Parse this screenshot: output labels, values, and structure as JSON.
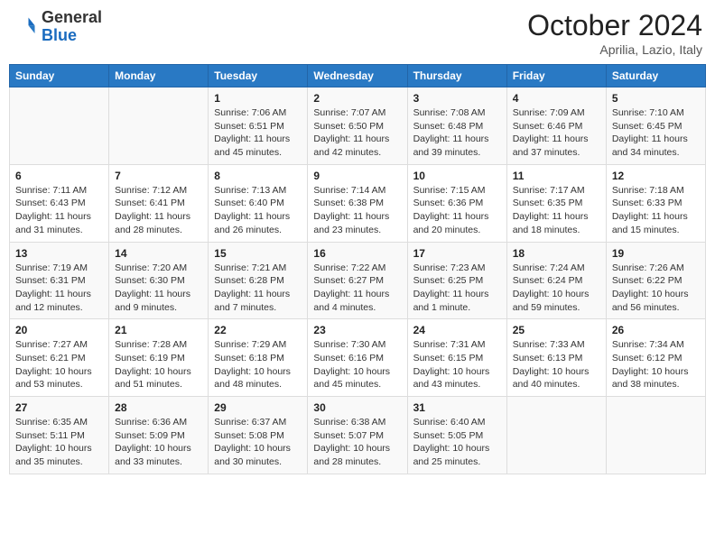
{
  "header": {
    "logo_general": "General",
    "logo_blue": "Blue",
    "month_title": "October 2024",
    "location": "Aprilia, Lazio, Italy"
  },
  "days_of_week": [
    "Sunday",
    "Monday",
    "Tuesday",
    "Wednesday",
    "Thursday",
    "Friday",
    "Saturday"
  ],
  "weeks": [
    [
      {
        "day": "",
        "info": ""
      },
      {
        "day": "",
        "info": ""
      },
      {
        "day": "1",
        "info": "Sunrise: 7:06 AM\nSunset: 6:51 PM\nDaylight: 11 hours and 45 minutes."
      },
      {
        "day": "2",
        "info": "Sunrise: 7:07 AM\nSunset: 6:50 PM\nDaylight: 11 hours and 42 minutes."
      },
      {
        "day": "3",
        "info": "Sunrise: 7:08 AM\nSunset: 6:48 PM\nDaylight: 11 hours and 39 minutes."
      },
      {
        "day": "4",
        "info": "Sunrise: 7:09 AM\nSunset: 6:46 PM\nDaylight: 11 hours and 37 minutes."
      },
      {
        "day": "5",
        "info": "Sunrise: 7:10 AM\nSunset: 6:45 PM\nDaylight: 11 hours and 34 minutes."
      }
    ],
    [
      {
        "day": "6",
        "info": "Sunrise: 7:11 AM\nSunset: 6:43 PM\nDaylight: 11 hours and 31 minutes."
      },
      {
        "day": "7",
        "info": "Sunrise: 7:12 AM\nSunset: 6:41 PM\nDaylight: 11 hours and 28 minutes."
      },
      {
        "day": "8",
        "info": "Sunrise: 7:13 AM\nSunset: 6:40 PM\nDaylight: 11 hours and 26 minutes."
      },
      {
        "day": "9",
        "info": "Sunrise: 7:14 AM\nSunset: 6:38 PM\nDaylight: 11 hours and 23 minutes."
      },
      {
        "day": "10",
        "info": "Sunrise: 7:15 AM\nSunset: 6:36 PM\nDaylight: 11 hours and 20 minutes."
      },
      {
        "day": "11",
        "info": "Sunrise: 7:17 AM\nSunset: 6:35 PM\nDaylight: 11 hours and 18 minutes."
      },
      {
        "day": "12",
        "info": "Sunrise: 7:18 AM\nSunset: 6:33 PM\nDaylight: 11 hours and 15 minutes."
      }
    ],
    [
      {
        "day": "13",
        "info": "Sunrise: 7:19 AM\nSunset: 6:31 PM\nDaylight: 11 hours and 12 minutes."
      },
      {
        "day": "14",
        "info": "Sunrise: 7:20 AM\nSunset: 6:30 PM\nDaylight: 11 hours and 9 minutes."
      },
      {
        "day": "15",
        "info": "Sunrise: 7:21 AM\nSunset: 6:28 PM\nDaylight: 11 hours and 7 minutes."
      },
      {
        "day": "16",
        "info": "Sunrise: 7:22 AM\nSunset: 6:27 PM\nDaylight: 11 hours and 4 minutes."
      },
      {
        "day": "17",
        "info": "Sunrise: 7:23 AM\nSunset: 6:25 PM\nDaylight: 11 hours and 1 minute."
      },
      {
        "day": "18",
        "info": "Sunrise: 7:24 AM\nSunset: 6:24 PM\nDaylight: 10 hours and 59 minutes."
      },
      {
        "day": "19",
        "info": "Sunrise: 7:26 AM\nSunset: 6:22 PM\nDaylight: 10 hours and 56 minutes."
      }
    ],
    [
      {
        "day": "20",
        "info": "Sunrise: 7:27 AM\nSunset: 6:21 PM\nDaylight: 10 hours and 53 minutes."
      },
      {
        "day": "21",
        "info": "Sunrise: 7:28 AM\nSunset: 6:19 PM\nDaylight: 10 hours and 51 minutes."
      },
      {
        "day": "22",
        "info": "Sunrise: 7:29 AM\nSunset: 6:18 PM\nDaylight: 10 hours and 48 minutes."
      },
      {
        "day": "23",
        "info": "Sunrise: 7:30 AM\nSunset: 6:16 PM\nDaylight: 10 hours and 45 minutes."
      },
      {
        "day": "24",
        "info": "Sunrise: 7:31 AM\nSunset: 6:15 PM\nDaylight: 10 hours and 43 minutes."
      },
      {
        "day": "25",
        "info": "Sunrise: 7:33 AM\nSunset: 6:13 PM\nDaylight: 10 hours and 40 minutes."
      },
      {
        "day": "26",
        "info": "Sunrise: 7:34 AM\nSunset: 6:12 PM\nDaylight: 10 hours and 38 minutes."
      }
    ],
    [
      {
        "day": "27",
        "info": "Sunrise: 6:35 AM\nSunset: 5:11 PM\nDaylight: 10 hours and 35 minutes."
      },
      {
        "day": "28",
        "info": "Sunrise: 6:36 AM\nSunset: 5:09 PM\nDaylight: 10 hours and 33 minutes."
      },
      {
        "day": "29",
        "info": "Sunrise: 6:37 AM\nSunset: 5:08 PM\nDaylight: 10 hours and 30 minutes."
      },
      {
        "day": "30",
        "info": "Sunrise: 6:38 AM\nSunset: 5:07 PM\nDaylight: 10 hours and 28 minutes."
      },
      {
        "day": "31",
        "info": "Sunrise: 6:40 AM\nSunset: 5:05 PM\nDaylight: 10 hours and 25 minutes."
      },
      {
        "day": "",
        "info": ""
      },
      {
        "day": "",
        "info": ""
      }
    ]
  ]
}
